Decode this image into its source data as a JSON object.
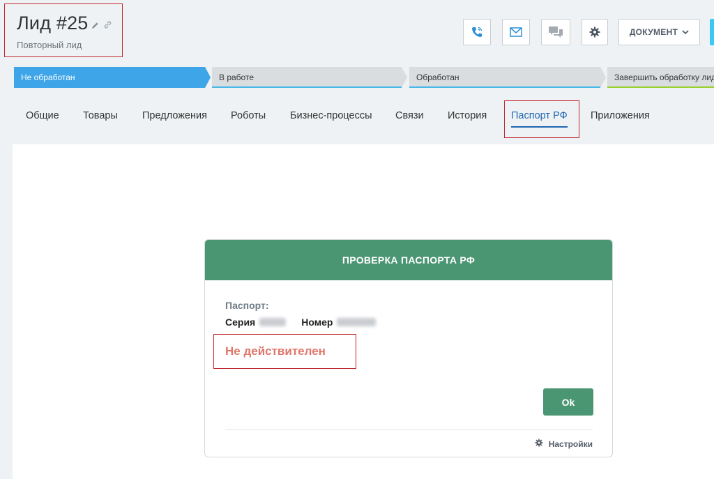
{
  "header": {
    "title": "Лид #25",
    "subtitle": "Повторный лид",
    "document_button": "ДОКУМЕНТ",
    "icons": [
      "edit-icon",
      "link-icon",
      "phone-icon",
      "mail-icon",
      "chat-icon",
      "gear-icon",
      "chevron-down-icon"
    ]
  },
  "stages": [
    {
      "label": "Не обработан"
    },
    {
      "label": "В работе"
    },
    {
      "label": "Обработан"
    },
    {
      "label": "Завершить обработку лида"
    }
  ],
  "tabs": [
    {
      "label": "Общие"
    },
    {
      "label": "Товары"
    },
    {
      "label": "Предложения"
    },
    {
      "label": "Роботы"
    },
    {
      "label": "Бизнес-процессы"
    },
    {
      "label": "Связи"
    },
    {
      "label": "История"
    },
    {
      "label": "Паспорт РФ"
    },
    {
      "label": "Приложения"
    }
  ],
  "active_tab": "Паспорт РФ",
  "dialog": {
    "title": "ПРОВЕРКА ПАСПОРТА РФ",
    "passport_label": "Паспорт:",
    "series_label": "Серия",
    "number_label": "Номер",
    "status": "Не действителен",
    "ok_button": "Ok",
    "settings_link": "Настройки"
  },
  "colors": {
    "accent_blue": "#3da5e8",
    "dialog_green": "#4b9672",
    "status_red": "#e0766a",
    "highlight_red": "#c0262d"
  }
}
